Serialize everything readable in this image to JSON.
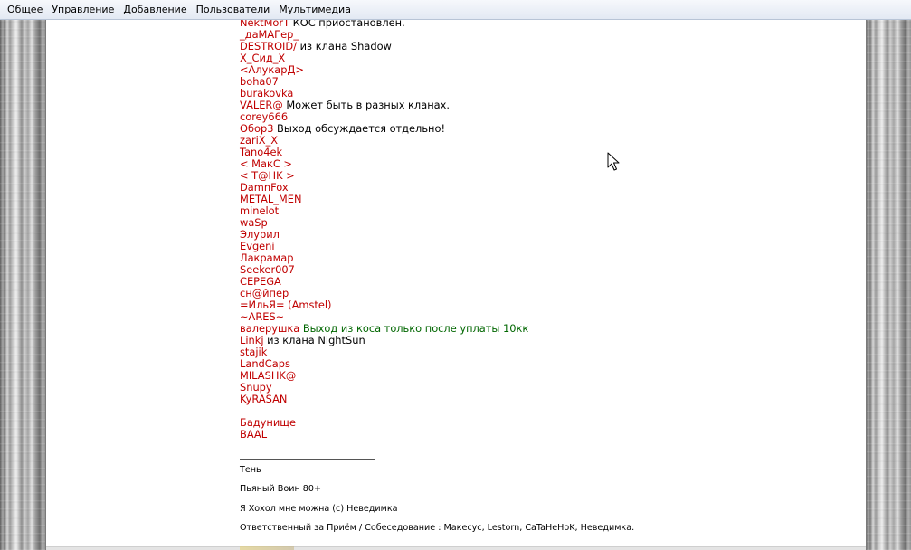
{
  "menu": [
    {
      "label": "Общее"
    },
    {
      "label": "Управление"
    },
    {
      "label": "Добавление"
    },
    {
      "label": "Пользователи"
    },
    {
      "label": "Мультимедиа"
    }
  ],
  "post": {
    "rows": [
      {
        "nick": "NektMorT",
        "note": " КОС приостановлен."
      },
      {
        "nick": "_даМАГер_"
      },
      {
        "nick": "DESTROID/",
        "note": " из клана Shadow"
      },
      {
        "nick": "X_Сид_X"
      },
      {
        "nick": "<АлукарД>"
      },
      {
        "nick": "boha07"
      },
      {
        "nick": "burakovka"
      },
      {
        "nick": "VALER@",
        "note": " Может быть в разных кланах."
      },
      {
        "nick": "corey666"
      },
      {
        "nick": "Обор3",
        "note": " Выход обсуждается отдельно!"
      },
      {
        "nick": "zariX_X"
      },
      {
        "nick": "Tano4ek"
      },
      {
        "nick": "< МакС >"
      },
      {
        "nick": "< T@HK >"
      },
      {
        "nick": "DamnFox"
      },
      {
        "nick": "METAL_MEN"
      },
      {
        "nick": "minelot"
      },
      {
        "nick": "waSp"
      },
      {
        "nick": "Элурил"
      },
      {
        "nick": "Evgeni"
      },
      {
        "nick": "Лакрамар"
      },
      {
        "nick": "Seeker007"
      },
      {
        "nick": "СЕРЕGA"
      },
      {
        "nick": "сн@йпер"
      },
      {
        "nick": "=ИльЯ= (Amstel)"
      },
      {
        "nick": "~ARES~"
      },
      {
        "nick": "валерушка",
        "note_green": " Выход из коса только после уплаты 10кк"
      },
      {
        "nick": "Linkj",
        "note": " из клана NightSun"
      },
      {
        "nick": "stajik"
      },
      {
        "nick": "LandCaps"
      },
      {
        "nick": "MILASHK@"
      },
      {
        "nick": "Snupy"
      },
      {
        "nick": "KyRASAN"
      },
      {
        "gap": true
      },
      {
        "nick": "Бадунище"
      },
      {
        "nick": "BAAL"
      }
    ]
  },
  "signature": {
    "lines": [
      "Тень",
      "Пьяный Воин 80+",
      "Я Хохол мне можна (с) Неведимка",
      "Ответственный за Приём / Собеседование : Макесус, Lestorn, CaTaHeHoK, Неведимка."
    ]
  },
  "colors": {
    "nick": "#c00000",
    "note_green": "#006600",
    "menubar": "#e8edf5"
  }
}
